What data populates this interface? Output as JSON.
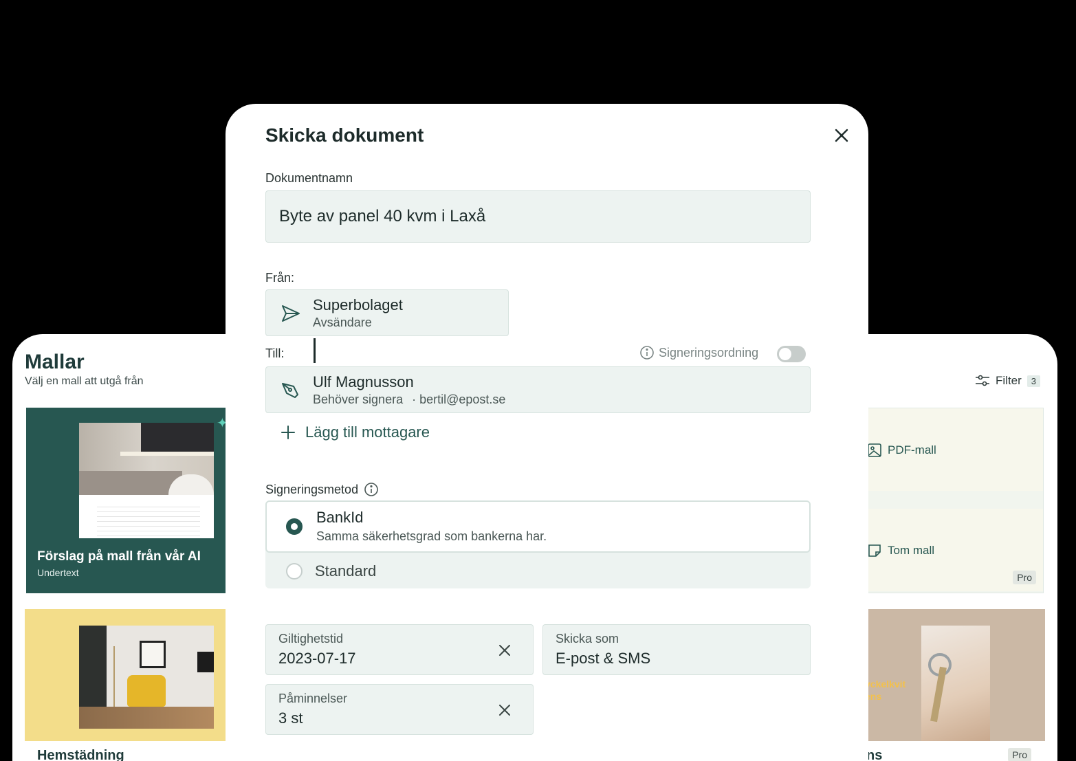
{
  "templates_panel": {
    "title": "Mallar",
    "subtitle": "Välj en mall att utgå från",
    "ai_card": {
      "title": "Förslag på mall från vår AI",
      "subtext": "Undertext"
    },
    "home_card": {
      "title": "Hemstädning"
    },
    "filter": {
      "label": "Filter",
      "count": "3"
    },
    "options": [
      {
        "label": "PDF-mall",
        "icon": "image-icon"
      },
      {
        "label": "Tom mall",
        "icon": "blank-note-icon",
        "badge": "Pro"
      }
    ],
    "keys_card": {
      "overlay_text_1": "yckelkvit",
      "overlay_text_2": "ens",
      "title": "ittens",
      "badge": "Pro"
    }
  },
  "modal": {
    "title": "Skicka dokument",
    "document_name_label": "Dokumentnamn",
    "document_name_value": "Byte av panel 40 kvm i Laxå",
    "from_label": "Från:",
    "sender": {
      "name": "Superbolaget",
      "role": "Avsändare"
    },
    "to_label": "Till:",
    "signing_order_label": "Signeringsordning",
    "signing_order_enabled": false,
    "recipient": {
      "name": "Ulf Magnusson",
      "status": "Behöver signera",
      "email": "· bertil@epost.se"
    },
    "add_recipient_label": "Lägg till mottagare",
    "signing_method_label": "Signeringsmetod",
    "signing_methods": [
      {
        "title": "BankId",
        "description": "Samma säkerhetsgrad som bankerna har.",
        "selected": true
      },
      {
        "title": "Standard",
        "selected": false
      }
    ],
    "validity": {
      "label": "Giltighetstid",
      "value": "2023-07-17"
    },
    "send_as": {
      "label": "Skicka som",
      "value": "E-post & SMS"
    },
    "reminders": {
      "label": "Påminnelser",
      "value": "3 st"
    }
  },
  "colors": {
    "accent": "#275751",
    "field_bg": "#edf3f1",
    "field_border": "#d6e2de",
    "background": "#000000"
  }
}
